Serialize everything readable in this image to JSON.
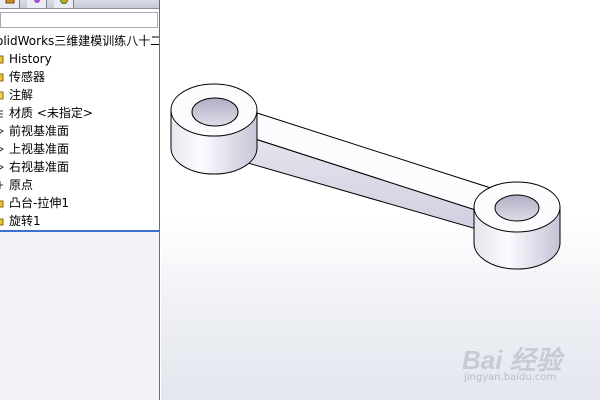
{
  "feature_manager": {
    "tree": [
      {
        "label": "olidWorks三维建模训练八十二",
        "icon": "part-icon"
      },
      {
        "label": "History",
        "icon": "history-folder-icon"
      },
      {
        "label": "传感器",
        "icon": "sensor-folder-icon"
      },
      {
        "label": "注解",
        "icon": "annotations-icon"
      },
      {
        "label": "材质 <未指定>",
        "icon": "material-icon"
      },
      {
        "label": "前视基准面",
        "icon": "plane-icon"
      },
      {
        "label": "上视基准面",
        "icon": "plane-icon"
      },
      {
        "label": "右视基准面",
        "icon": "plane-icon"
      },
      {
        "label": "原点",
        "icon": "origin-icon"
      },
      {
        "label": "凸台-拉伸1",
        "icon": "extrude-icon"
      },
      {
        "label": "旋转1",
        "icon": "revolve-icon"
      }
    ],
    "tabs": [
      "feature-tree-tab",
      "property-manager-tab",
      "appearance-tab"
    ]
  },
  "watermark": {
    "main": "Bai 经验",
    "sub": "jingyan.baidu.com"
  },
  "colors": {
    "tree_selection_line": "#3b6fd1",
    "model_light": "#fcfcff",
    "model_shade": "#cfcbdc",
    "model_hole": "#b9b3c9"
  }
}
